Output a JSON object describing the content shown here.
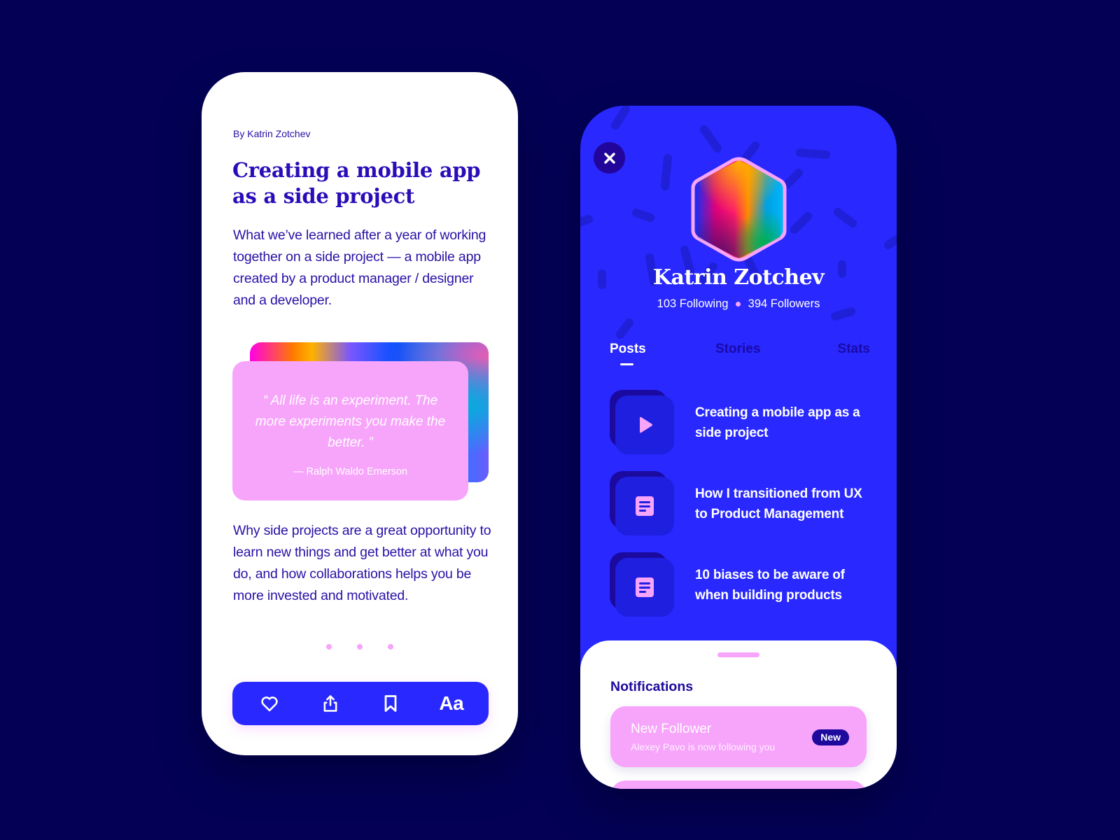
{
  "article": {
    "byline": "By Katrin Zotchev",
    "title": "Creating a mobile app as a side project",
    "intro": "What we’ve learned after a year of working together on a side project — a mobile app created by a product manager / designer and a developer.",
    "quote": {
      "text": "“ All life is an experiment. The more experiments you make the better. ”",
      "author": "— Ralph Waldo Emerson"
    },
    "body": "Why side projects are a great opportunity to learn new things and get better at what you do, and how collaborations helps you be more invested and motivated.",
    "pager": {
      "pages": 3
    },
    "toolbar": {
      "like_icon": "heart-icon",
      "share_icon": "share-icon",
      "bookmark_icon": "bookmark-icon",
      "font_label": "Aa"
    }
  },
  "profile": {
    "close_icon": "close-icon",
    "name": "Katrin Zotchev",
    "following": "103 Following",
    "followers": "394 Followers",
    "tabs": [
      {
        "label": "Posts",
        "active": true
      },
      {
        "label": "Stories",
        "active": false
      },
      {
        "label": "Stats",
        "active": false
      }
    ],
    "posts": [
      {
        "title": "Creating a mobile app as a side project",
        "icon": "play-icon"
      },
      {
        "title": "How I transitioned from UX to Product Management",
        "icon": "document-icon"
      },
      {
        "title": "10 biases to be aware of when building products",
        "icon": "document-icon"
      }
    ],
    "notifications": {
      "title": "Notifications",
      "items": [
        {
          "title": "New Follower",
          "subtitle": "Alexey Pavo is now following you",
          "badge": "New"
        }
      ]
    }
  },
  "colors": {
    "background": "#030056",
    "primary_blue": "#2828ff",
    "deep_indigo": "#1e0a9c",
    "pink": "#f7a4fb",
    "text_indigo": "#2a10a6"
  }
}
